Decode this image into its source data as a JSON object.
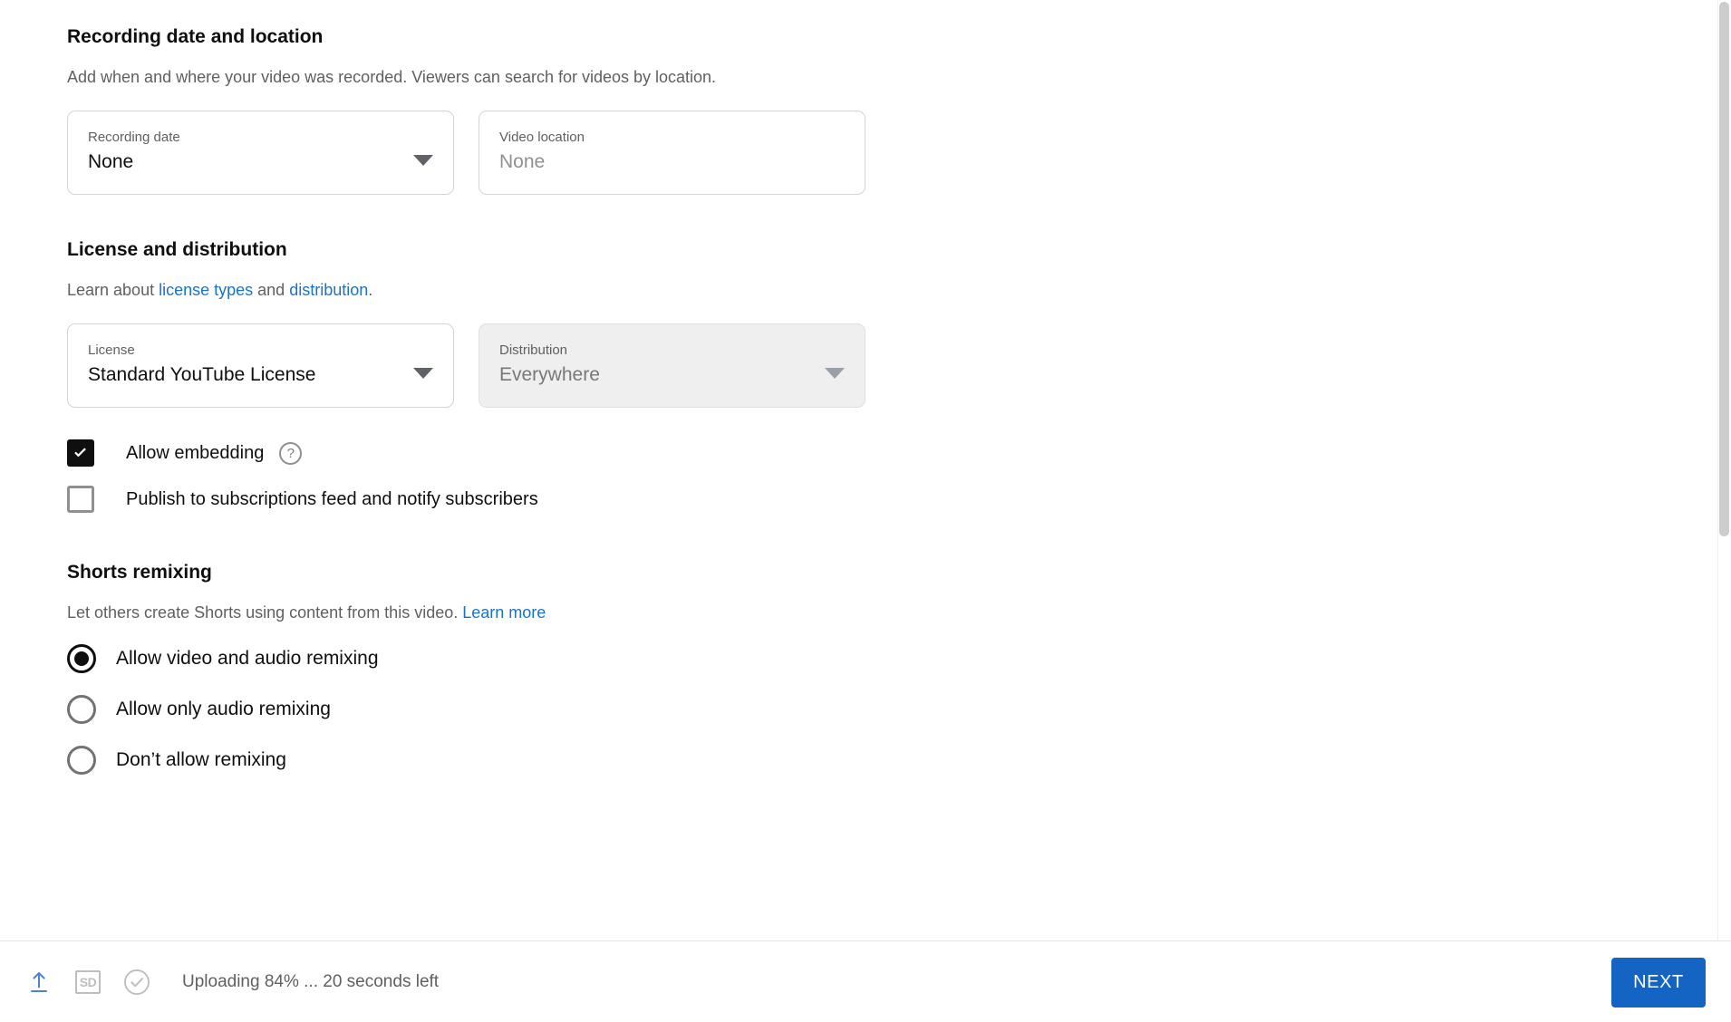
{
  "recording": {
    "title": "Recording date and location",
    "description": "Add when and where your video was recorded. Viewers can search for videos by location.",
    "date_field": {
      "label": "Recording date",
      "value": "None",
      "caret": "chevron-down-icon"
    },
    "location_field": {
      "label": "Video location",
      "placeholder": "None",
      "value": ""
    }
  },
  "license": {
    "title": "License and distribution",
    "desc_prefix": "Learn about ",
    "link_license": "license types",
    "desc_middle": " and ",
    "link_distribution": "distribution",
    "desc_suffix": ".",
    "license_field": {
      "label": "License",
      "value": "Standard YouTube License"
    },
    "distribution_field": {
      "label": "Distribution",
      "value": "Everywhere",
      "disabled": true
    },
    "checkbox_embedding": {
      "label": "Allow embedding",
      "checked": true,
      "help": "?"
    },
    "checkbox_notify": {
      "label": "Publish to subscriptions feed and notify subscribers",
      "checked": false
    }
  },
  "shorts": {
    "title": "Shorts remixing",
    "desc": "Let others create Shorts using content from this video. ",
    "learn_more": "Learn more",
    "options": [
      {
        "label": "Allow video and audio remixing",
        "selected": true
      },
      {
        "label": "Allow only audio remixing",
        "selected": false
      },
      {
        "label": "Don’t allow remixing",
        "selected": false
      }
    ]
  },
  "bottom_bar": {
    "upload_icon": "upload-arrow-icon",
    "quality_badge": "SD",
    "checks_icon": "check-circle-icon",
    "status": "Uploading 84% ... 20 seconds left",
    "next_label": "NEXT"
  },
  "colors": {
    "link_blue": "#1a73c8",
    "button_blue": "#1464c4",
    "upload_icon_blue": "#4f81d8"
  }
}
